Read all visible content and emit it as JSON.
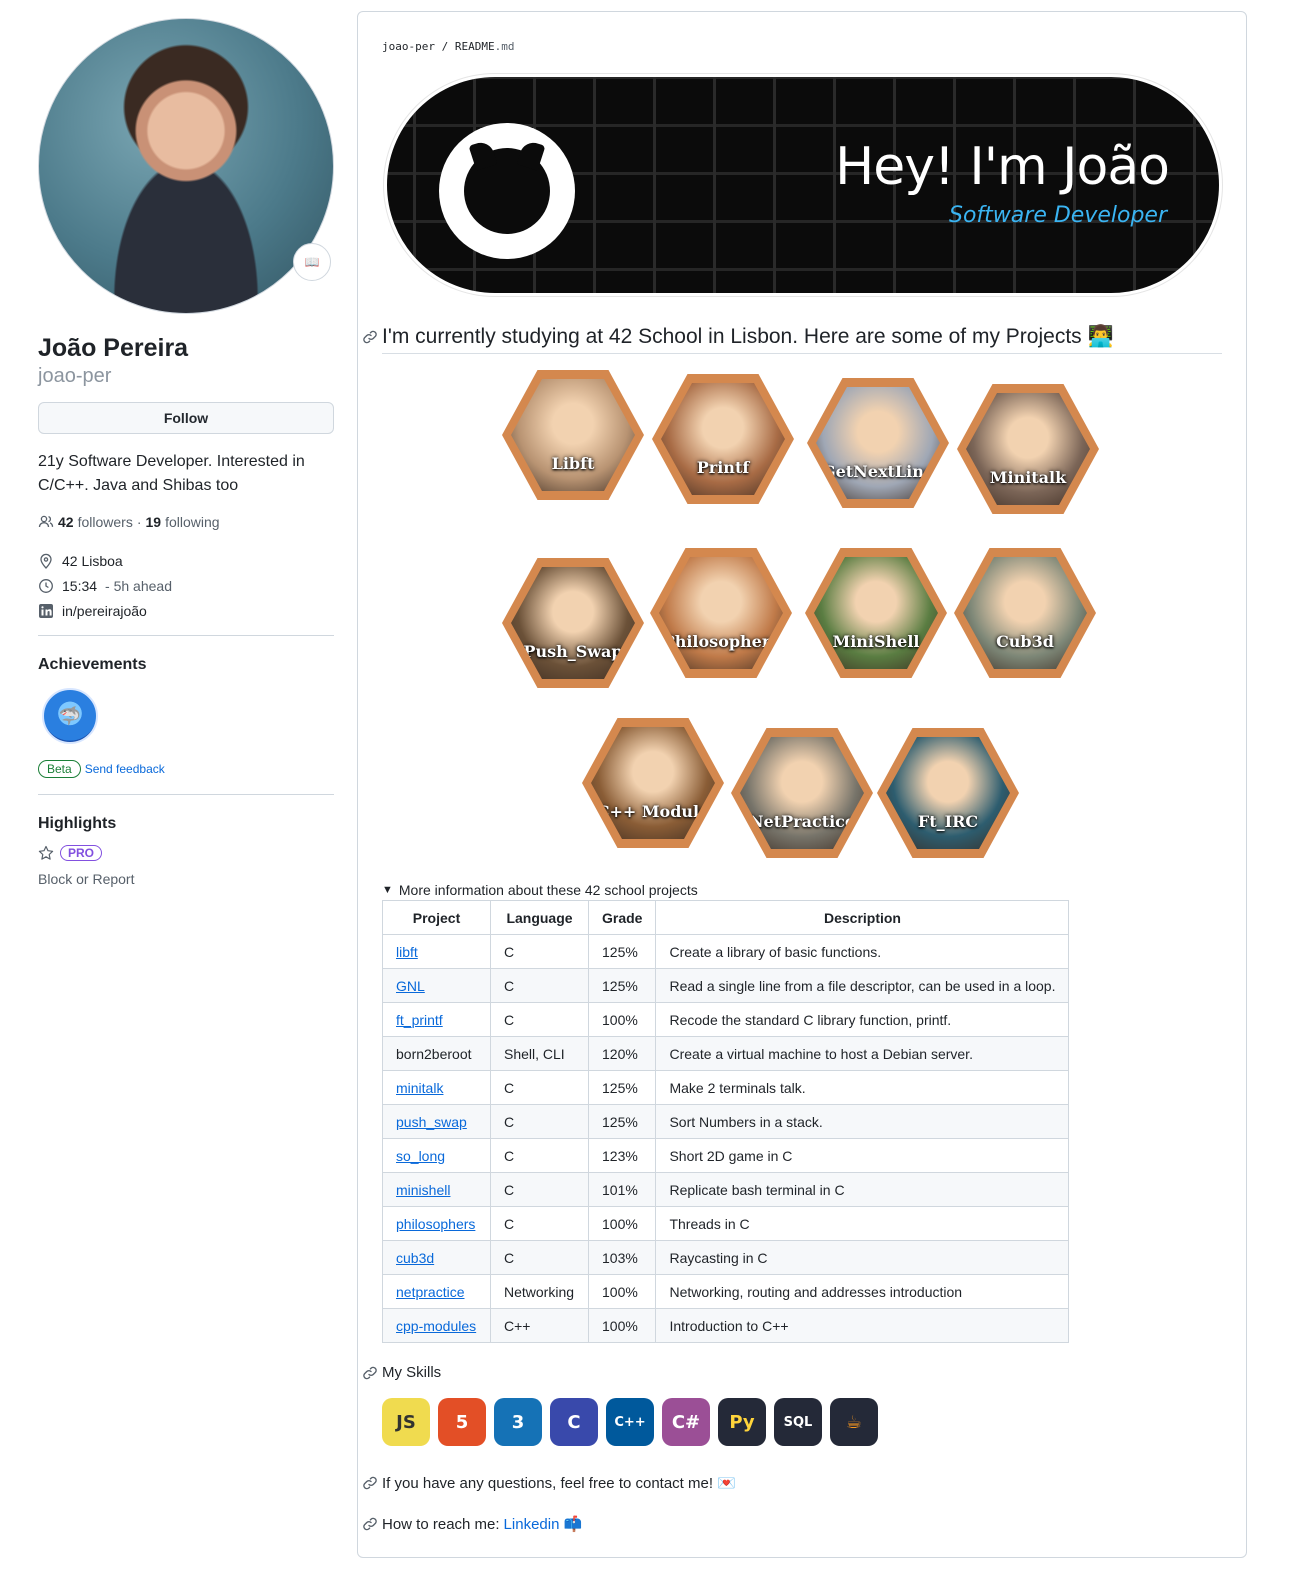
{
  "profile": {
    "name": "João Pereira",
    "login": "joao-per",
    "follow_label": "Follow",
    "bio": "21y Software Developer. Interested in C/C++. Java and Shibas too",
    "followers_count": "42",
    "followers_label": "followers",
    "separator": "·",
    "following_count": "19",
    "following_label": "following",
    "location": "42 Lisboa",
    "time": "15:34",
    "time_suffix": "- 5h ahead",
    "linkedin": "in/pereirajoão",
    "status_emoji": "📖"
  },
  "achievements": {
    "title": "Achievements",
    "beta_label": "Beta",
    "feedback_label": "Send feedback"
  },
  "highlights": {
    "title": "Highlights",
    "pro_label": "PRO",
    "report_label": "Block or Report"
  },
  "readme": {
    "repo": "joao-per",
    "slash": " / ",
    "file": "README",
    "ext": ".md",
    "banner_title": "Hey! I'm João",
    "banner_subtitle": "Software Developer",
    "projects_heading": "I'm currently studying at 42 School in Lisbon. Here are some of my Projects 👨‍💻",
    "projects": [
      {
        "label": "Libft",
        "color": "#b89372"
      },
      {
        "label": "Printf",
        "color": "#a86b45"
      },
      {
        "label": "GetNextLine",
        "color": "#9fa7b5"
      },
      {
        "label": "Minitalk",
        "color": "#7b6557"
      },
      {
        "label": "Push_Swap",
        "color": "#6b5138"
      },
      {
        "label": "Philosophers",
        "color": "#c07a49"
      },
      {
        "label": "MiniShell",
        "color": "#5a7d42"
      },
      {
        "label": "Cub3d",
        "color": "#7d8777"
      },
      {
        "label": "C++ Module",
        "color": "#8a5d36"
      },
      {
        "label": "NetPractice",
        "color": "#77746a"
      },
      {
        "label": "Ft_IRC",
        "color": "#2d5d6f"
      }
    ],
    "summary": "More information about these 42 school projects",
    "table": {
      "headers": [
        "Project",
        "Language",
        "Grade",
        "Description"
      ],
      "rows": [
        {
          "project": "libft",
          "language": "C",
          "grade": "125%",
          "description": "Create a library of basic functions."
        },
        {
          "project": "GNL",
          "language": "C",
          "grade": "125%",
          "description": "Read a single line from a file descriptor, can be used in a loop."
        },
        {
          "project": "ft_printf",
          "language": "C",
          "grade": "100%",
          "description": "Recode the standard C library function, printf."
        },
        {
          "project": "born2beroot",
          "language": "Shell, CLI",
          "grade": "120%",
          "description": "Create a virtual machine to host a Debian server."
        },
        {
          "project": "minitalk",
          "language": "C",
          "grade": "125%",
          "description": "Make 2 terminals talk."
        },
        {
          "project": "push_swap",
          "language": "C",
          "grade": "125%",
          "description": "Sort Numbers in a stack."
        },
        {
          "project": "so_long",
          "language": "C",
          "grade": "123%",
          "description": "Short 2D game in C"
        },
        {
          "project": "minishell",
          "language": "C",
          "grade": "101%",
          "description": "Replicate bash terminal in C"
        },
        {
          "project": "philosophers",
          "language": "C",
          "grade": "100%",
          "description": "Threads in C"
        },
        {
          "project": "cub3d",
          "language": "C",
          "grade": "103%",
          "description": "Raycasting in C"
        },
        {
          "project": "netpractice",
          "language": "Networking",
          "grade": "100%",
          "description": "Networking, routing and addresses introduction"
        },
        {
          "project": "cpp-modules",
          "language": "C++",
          "grade": "100%",
          "description": "Introduction to C++"
        }
      ]
    },
    "skills_heading": "My Skills",
    "skills": [
      {
        "text": "JS",
        "icon": "javascript-icon",
        "bg": "#f0db4f",
        "fg": "#323330"
      },
      {
        "text": "5",
        "icon": "html5-icon",
        "bg": "#e34f26",
        "fg": "#ffffff"
      },
      {
        "text": "3",
        "icon": "css3-icon",
        "bg": "#1572b6",
        "fg": "#ffffff"
      },
      {
        "text": "C",
        "icon": "c-icon",
        "bg": "#3949ab",
        "fg": "#ffffff"
      },
      {
        "text": "C++",
        "icon": "cplusplus-icon",
        "bg": "#00599c",
        "fg": "#ffffff"
      },
      {
        "text": "C#",
        "icon": "csharp-icon",
        "bg": "#9b4f96",
        "fg": "#ffffff"
      },
      {
        "text": "Py",
        "icon": "python-icon",
        "bg": "#242938",
        "fg": "#ffd43b"
      },
      {
        "text": "SQL",
        "icon": "mysql-icon",
        "bg": "#242938",
        "fg": "#ffffff"
      },
      {
        "text": "☕",
        "icon": "java-icon",
        "bg": "#242938",
        "fg": "#f89820"
      }
    ],
    "contact_text": "If you have any questions, feel free to contact me! 💌",
    "reach_text": "How to reach me:",
    "reach_link": "Linkedin",
    "reach_emoji": "📫"
  }
}
